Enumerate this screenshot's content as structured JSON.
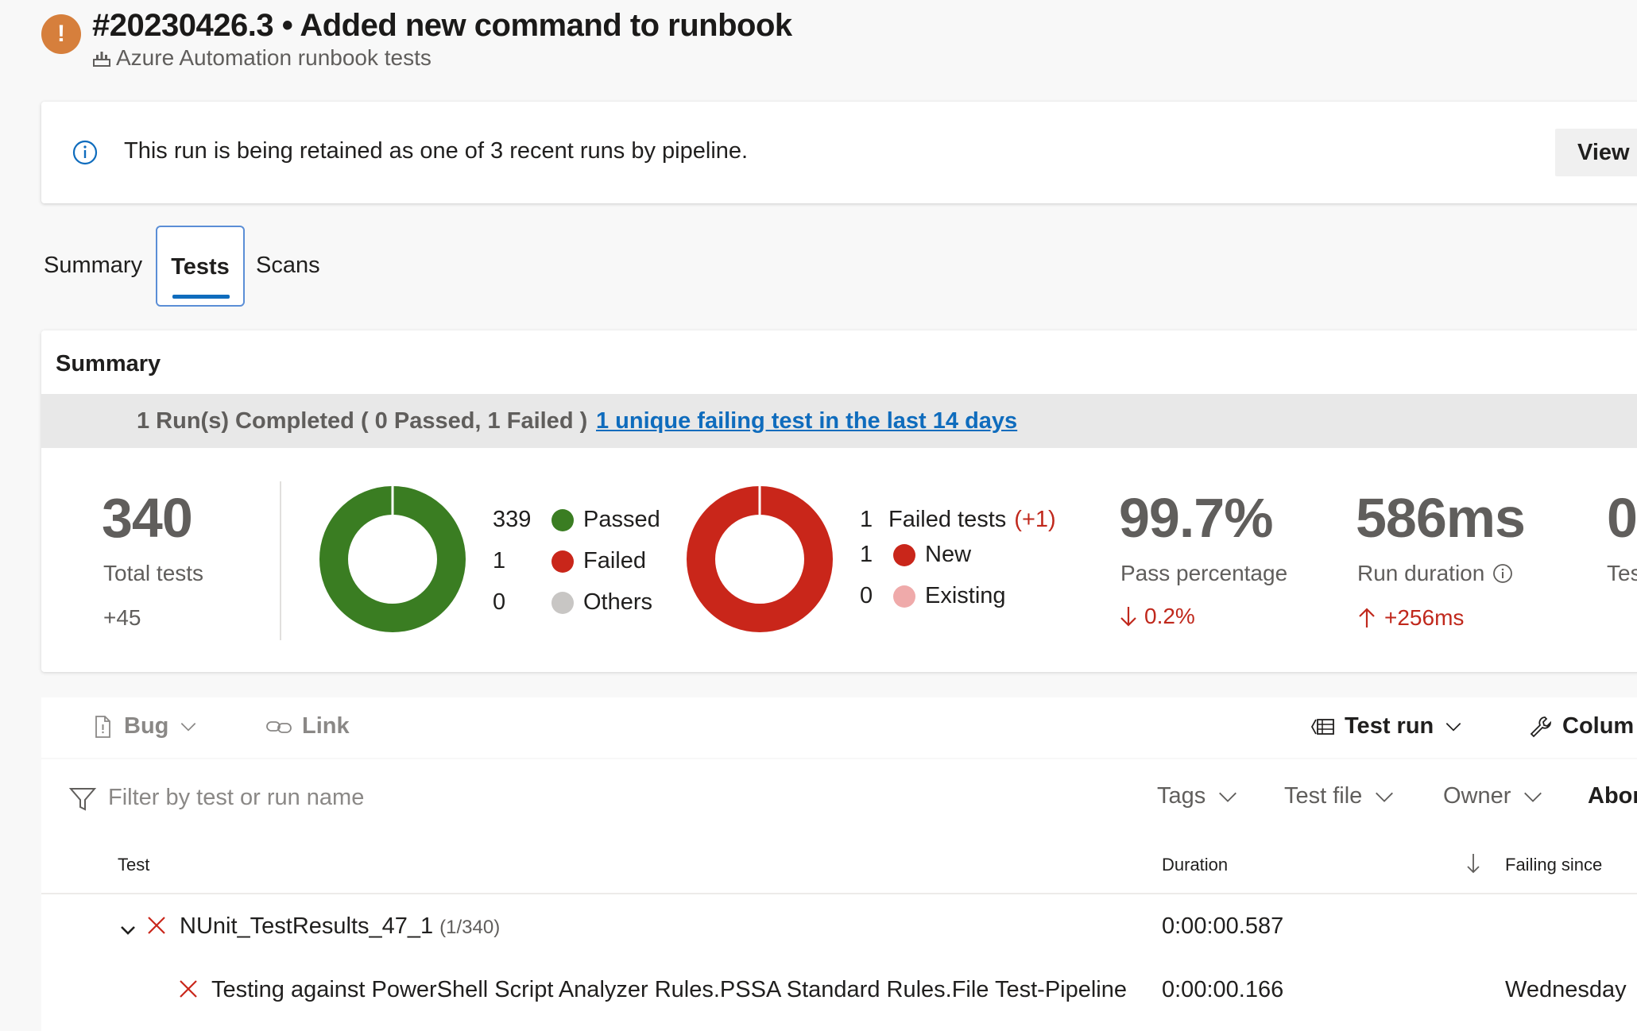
{
  "header": {
    "title": "#20230426.3 • Added new command to runbook",
    "pipeline": "Azure Automation runbook tests"
  },
  "banner": {
    "message": "This run is being retained as one of 3 recent runs by pipeline.",
    "view_button": "View r"
  },
  "tabs": [
    {
      "label": "Summary"
    },
    {
      "label": "Tests",
      "selected": true
    },
    {
      "label": "Scans"
    }
  ],
  "summary": {
    "title": "Summary",
    "run_status": "1 Run(s) Completed ( 0 Passed, 1 Failed )",
    "failing_link": "1 unique failing test in the last 14 days",
    "total": {
      "value": "340",
      "label": "Total tests",
      "delta": "+45"
    },
    "outcome": {
      "passed_count": 339,
      "failed_count": 1,
      "others_count": 0,
      "passed_label": "Passed",
      "failed_label": "Failed",
      "others_label": "Others",
      "rows": [
        {
          "count": "339",
          "label": "Passed"
        },
        {
          "count": "1",
          "label": "Failed"
        },
        {
          "count": "0",
          "label": "Others"
        }
      ]
    },
    "failures": {
      "failed_count": "1",
      "failed_label": "Failed tests",
      "failed_delta": "(+1)",
      "new_count": "1",
      "new_label": "New",
      "existing_count": "0",
      "existing_label": "Existing",
      "new_value": 1,
      "existing_value": 0
    },
    "pass_percentage": {
      "value": "99.7%",
      "label": "Pass percentage",
      "delta": "0.2%"
    },
    "run_duration": {
      "value": "586ms",
      "label": "Run duration",
      "delta": "+256ms"
    },
    "clipped": {
      "value": "0",
      "label": "Tes"
    }
  },
  "colors": {
    "passed": "#3a7d22",
    "failed": "#c9261a",
    "others": "#c8c6c4",
    "existing": "#efaaaa",
    "link": "#0f6cbd",
    "warning": "#d67f3c"
  },
  "toolbar": {
    "bug": "Bug",
    "link": "Link",
    "test_run": "Test run",
    "columns": "Colum"
  },
  "filter": {
    "placeholder": "Filter by test or run name",
    "tags": "Tags",
    "test_file": "Test file",
    "owner": "Owner",
    "outcome": "Abor"
  },
  "table": {
    "columns": {
      "test": "Test",
      "duration": "Duration",
      "failing_since": "Failing since"
    },
    "group": {
      "name": "NUnit_TestResults_47_1",
      "count": "(1/340)",
      "duration": "0:00:00.587"
    },
    "rows": [
      {
        "name": "Testing against PowerShell Script Analyzer Rules.PSSA Standard Rules.File Test-Pipeline",
        "duration": "0:00:00.166",
        "failing_since": "Wednesday"
      }
    ]
  }
}
